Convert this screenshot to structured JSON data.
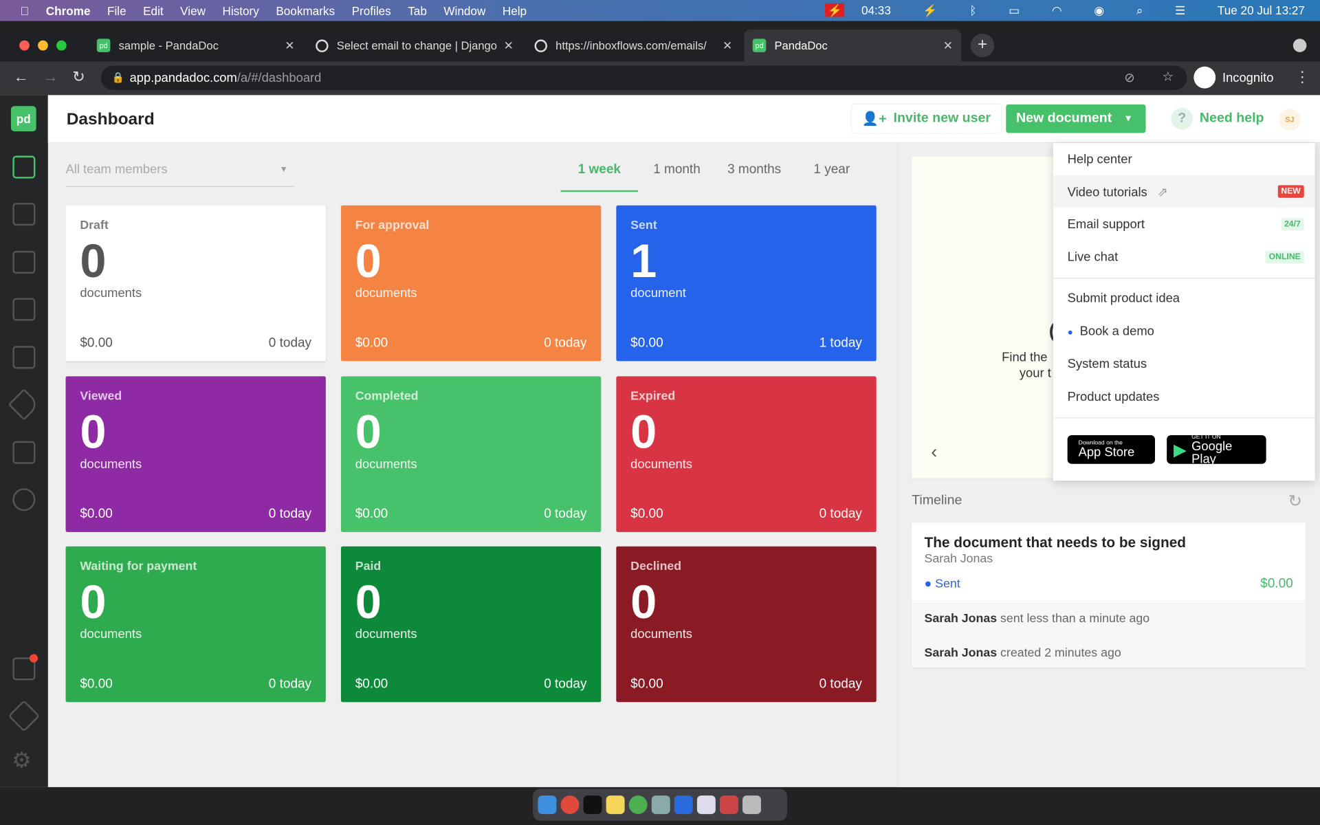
{
  "menubar": {
    "app": "Chrome",
    "items": [
      "File",
      "Edit",
      "View",
      "History",
      "Bookmarks",
      "Profiles",
      "Tab",
      "Window",
      "Help"
    ],
    "timer": "04:33",
    "datetime": "Tue 20 Jul  13:27"
  },
  "tabs": [
    {
      "title": "sample - PandaDoc"
    },
    {
      "title": "Select email to change | Django"
    },
    {
      "title": "https://inboxflows.com/emails/"
    },
    {
      "title": "PandaDoc"
    }
  ],
  "address": {
    "host": "app.pandadoc.com",
    "path": "/a/#/dashboard",
    "profile": "Incognito"
  },
  "header": {
    "title": "Dashboard",
    "invite": "Invite new user",
    "new_doc": "New document",
    "help": "Need help",
    "avatar": "SJ"
  },
  "filters": {
    "member_placeholder": "All team members",
    "periods": [
      "1 week",
      "1 month",
      "3 months",
      "1 year"
    ],
    "active_period": "1 week"
  },
  "cards": [
    {
      "label": "Draft",
      "count": "0",
      "unit": "documents",
      "amount": "$0.00",
      "today": "0 today",
      "color": "#ffffff"
    },
    {
      "label": "For approval",
      "count": "0",
      "unit": "documents",
      "amount": "$0.00",
      "today": "0 today",
      "color": "#f58442"
    },
    {
      "label": "Sent",
      "count": "1",
      "unit": "document",
      "amount": "$0.00",
      "today": "1 today",
      "color": "#2563eb"
    },
    {
      "label": "Viewed",
      "count": "0",
      "unit": "documents",
      "amount": "$0.00",
      "today": "0 today",
      "color": "#8e2aa3"
    },
    {
      "label": "Completed",
      "count": "0",
      "unit": "documents",
      "amount": "$0.00",
      "today": "0 today",
      "color": "#47c26a"
    },
    {
      "label": "Expired",
      "count": "0",
      "unit": "documents",
      "amount": "$0.00",
      "today": "0 today",
      "color": "#d93444"
    },
    {
      "label": "Waiting for payment",
      "count": "0",
      "unit": "documents",
      "amount": "$0.00",
      "today": "0 today",
      "color": "#2eaa4f"
    },
    {
      "label": "Paid",
      "count": "0",
      "unit": "documents",
      "amount": "$0.00",
      "today": "0 today",
      "color": "#0c8a3a"
    },
    {
      "label": "Declined",
      "count": "0",
      "unit": "documents",
      "amount": "$0.00",
      "today": "0 today",
      "color": "#8a1a24"
    }
  ],
  "promo": {
    "line1": "Find the",
    "line2": "your t"
  },
  "timeline": {
    "label": "Timeline",
    "doc_title": "The document that needs to be signed",
    "recipient": "Sarah Jonas",
    "status": "Sent",
    "amount": "$0.00",
    "events": [
      {
        "who": "Sarah Jonas",
        "what": "sent less than a minute ago"
      },
      {
        "who": "Sarah Jonas",
        "what": "created 2 minutes ago"
      }
    ]
  },
  "help_menu": {
    "items": [
      "Help center",
      "Video tutorials",
      "Email support",
      "Live chat",
      "Submit product idea",
      "Book a demo",
      "System status",
      "Product updates"
    ],
    "badges": {
      "new": "NEW",
      "email": "24/7",
      "chat": "ONLINE"
    },
    "app_store": {
      "small": "Download on the",
      "big": "App Store"
    },
    "google_play": {
      "small": "GET IT ON",
      "big": "Google Play"
    }
  }
}
